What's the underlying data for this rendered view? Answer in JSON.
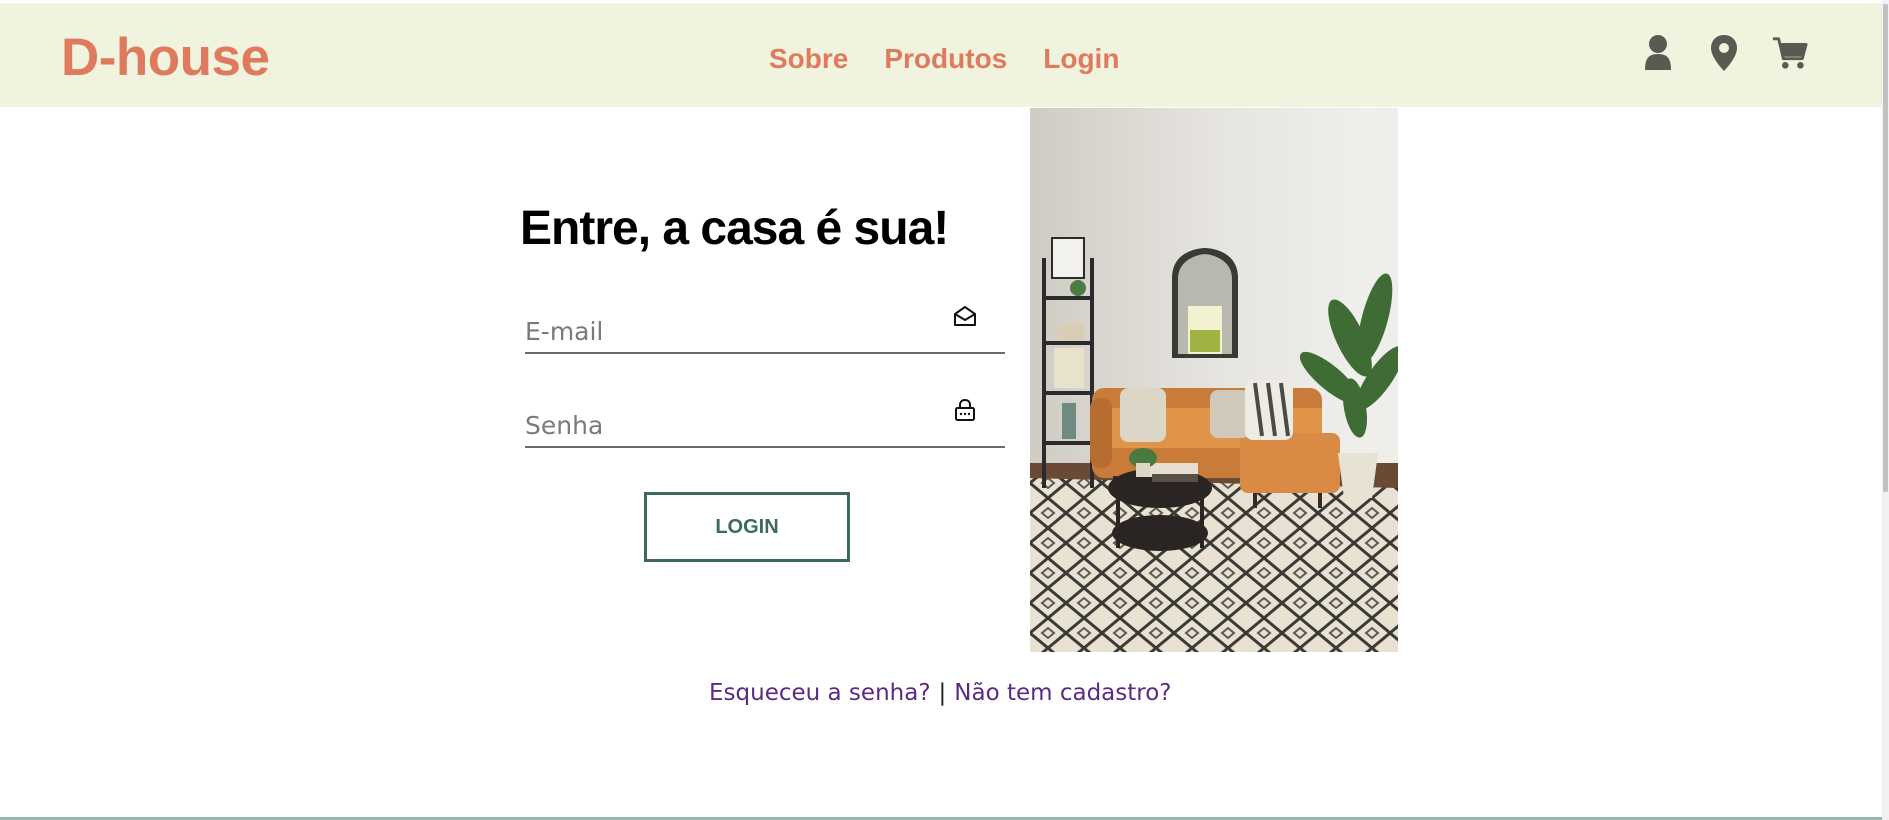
{
  "header": {
    "brand": "D-house",
    "nav": [
      "Sobre",
      "Produtos",
      "Login"
    ],
    "icons": [
      "user-icon",
      "map-pin-icon",
      "cart-icon"
    ],
    "background_color": "#f0f3dd",
    "accent_color": "#e07a5f",
    "icon_color": "#5a5a52"
  },
  "login": {
    "title": "Entre, a casa é sua!",
    "email_placeholder": "E-mail",
    "password_placeholder": "Senha",
    "email_icon": "envelope-open-icon",
    "password_icon": "lock-icon",
    "button_label": "LOGIN",
    "button_color": "#3d6b5a"
  },
  "photo": {
    "icon": "living-room-photo"
  },
  "footer": {
    "forgot_password": "Esqueceu a senha?",
    "separator": "|",
    "no_account": "Não tem cadastro?",
    "link_color": "#5b2a86"
  }
}
